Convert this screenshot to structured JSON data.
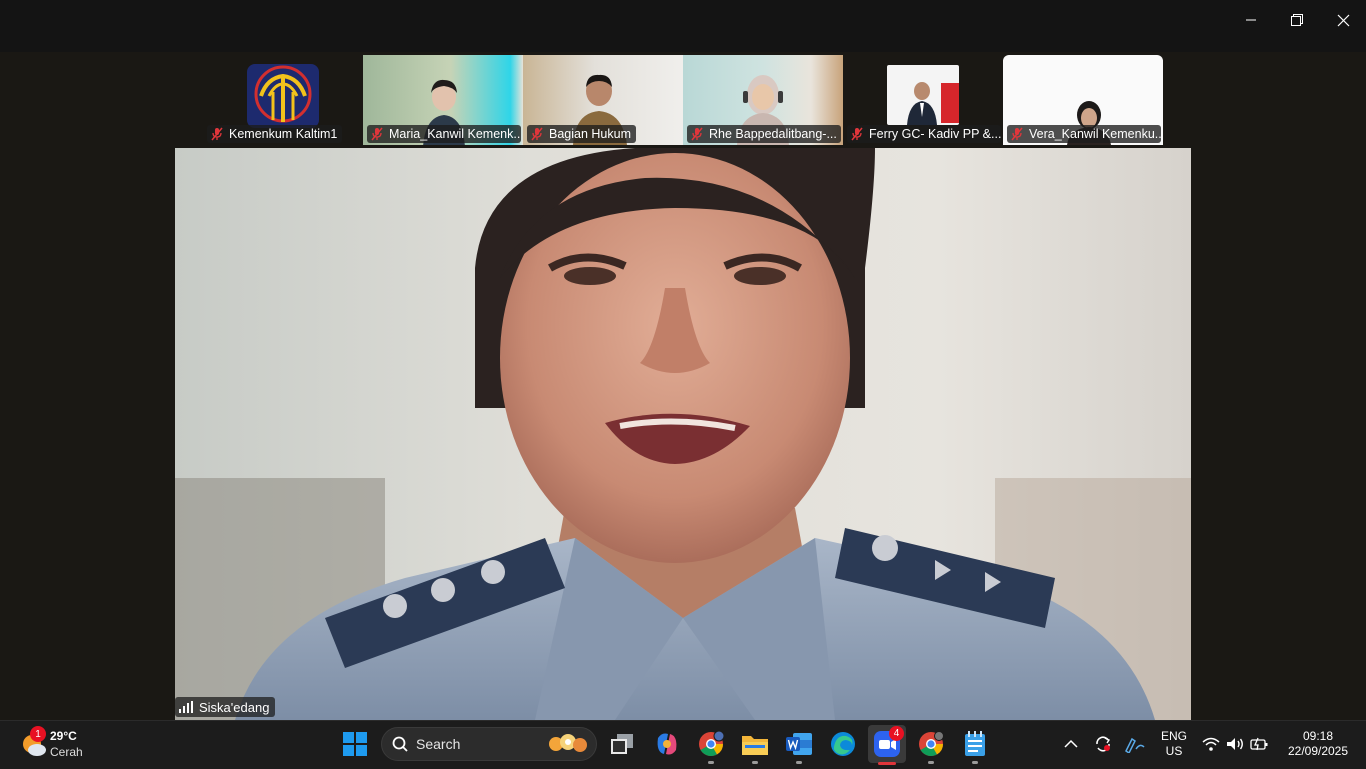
{
  "participants": [
    {
      "name": "Kemenkum Kaltim1",
      "muted": true
    },
    {
      "name": "Maria_Kanwil Kemenk...",
      "muted": true
    },
    {
      "name": "Bagian Hukum",
      "muted": true
    },
    {
      "name": "Rhe Bappedalitbang-...",
      "muted": true
    },
    {
      "name": "Ferry GC- Kadiv PP &...",
      "muted": true
    },
    {
      "name": "Vera_Kanwil Kemenku...",
      "muted": true
    }
  ],
  "active_speaker": {
    "name": "Siska'edang"
  },
  "taskbar": {
    "weather": {
      "temp": "29°C",
      "condition": "Cerah",
      "badge": "1"
    },
    "search_label": "Search",
    "zoom_badge": "4",
    "language": {
      "lang": "ENG",
      "region": "US"
    },
    "clock": {
      "time": "09:18",
      "date": "22/09/2025"
    }
  },
  "colors": {
    "mute_red": "#e0363b",
    "taskbar_bg": "#1c1c1c",
    "badge_red": "#e81123"
  }
}
